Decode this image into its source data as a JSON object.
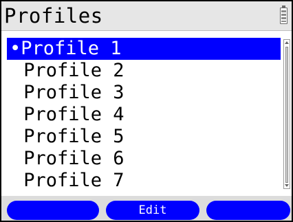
{
  "header": {
    "title": "Profiles",
    "battery_icon": "battery-icon"
  },
  "list": {
    "items": [
      {
        "label": "•Profile 1",
        "selected": true
      },
      {
        "label": " Profile 2",
        "selected": false
      },
      {
        "label": " Profile 3",
        "selected": false
      },
      {
        "label": " Profile 4",
        "selected": false
      },
      {
        "label": " Profile 5",
        "selected": false
      },
      {
        "label": " Profile 6",
        "selected": false
      },
      {
        "label": " Profile 7",
        "selected": false
      }
    ]
  },
  "softkeys": {
    "left": "",
    "middle": "Edit",
    "right": ""
  },
  "colors": {
    "accent": "#0000ff",
    "titlebar": "#e6e6e6",
    "softkey_bar": "#dcdcdc"
  }
}
